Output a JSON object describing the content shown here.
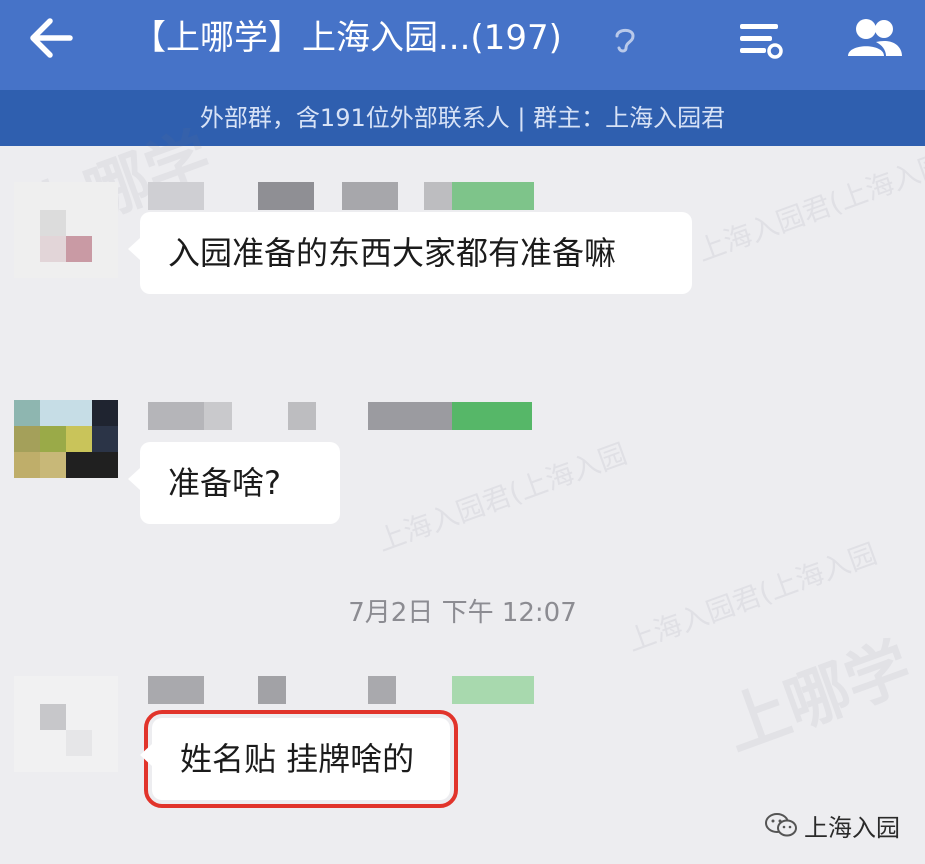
{
  "header": {
    "back_icon": "back-arrow-icon",
    "title": "【上哪学】上海入园...(197)",
    "ear_icon": "ear-icon",
    "filter_icon": "chat-settings-icon",
    "members_icon": "group-members-icon"
  },
  "subheader": {
    "text": "外部群，含191位外部联系人 | 群主：上海入园君"
  },
  "messages": [
    {
      "text": "入园准备的东西大家都有准备嘛"
    },
    {
      "text": "准备啥?"
    },
    {
      "text": "姓名贴 挂牌啥的"
    }
  ],
  "timestamp": "7月2日 下午 12:07",
  "watermarks": [
    "上哪学",
    "上海入园君(上海入园",
    "上海入园君(上海入园",
    "上海入园君(上海入园",
    "上哪学"
  ],
  "footer": {
    "icon": "wechat-icon",
    "label": "上海入园"
  },
  "colors": {
    "header_bg": "#4673c8",
    "subheader_bg": "#2f5faf",
    "chat_bg": "#ededf0",
    "highlight_border": "#e1342b"
  }
}
